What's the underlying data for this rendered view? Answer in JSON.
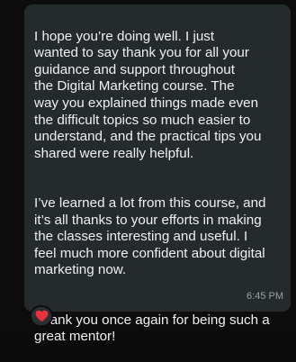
{
  "message": {
    "paragraphs": [
      "I hope you’re doing well. I just\nwanted to say thank you for all your\nguidance and support throughout\nthe Digital Marketing course. The\nway you explained things made even\nthe difficult topics so much easier to\nunderstand, and the practical tips you\nshared were really helpful.",
      "I’ve learned a lot from this course, and\nit’s all thanks to your efforts in making\nthe classes interesting and useful. I\nfeel much more confident about digital\nmarketing now.",
      "Thank you once again for being such a\ngreat mentor!"
    ],
    "time": "6:45 PM"
  },
  "reaction": {
    "icon": "red-heart-icon",
    "color": "#e8333f"
  },
  "colors": {
    "bubble": "#252a2c",
    "text": "#eef0f1",
    "timestamp": "#9aa0a3"
  }
}
